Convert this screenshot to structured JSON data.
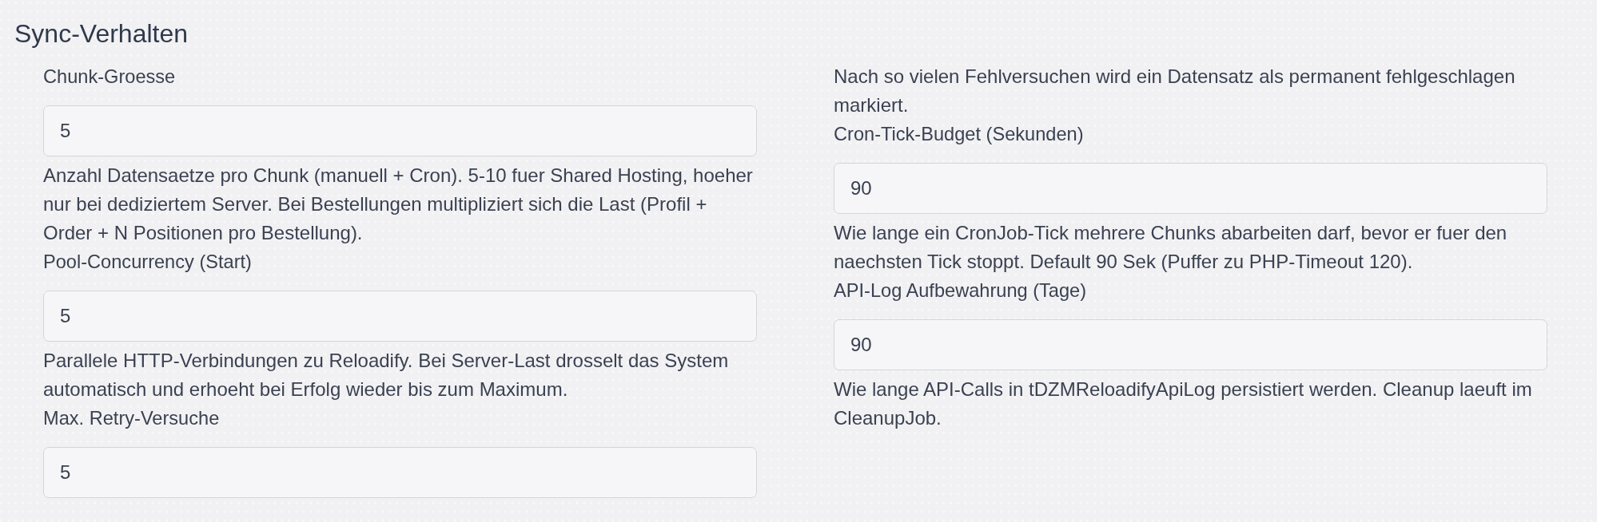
{
  "section": {
    "title": "Sync-Verhalten",
    "columns": [
      {
        "items": [
          {
            "kind": "label",
            "text": "Chunk-Groesse"
          },
          {
            "kind": "input",
            "value": "5"
          },
          {
            "kind": "help",
            "text": "Anzahl Datensaetze pro Chunk (manuell + Cron). 5-10 fuer Shared Hosting, hoeher nur bei dediziertem Server. Bei Bestellungen multipliziert sich die Last (Profil + Order + N Positionen pro Bestellung)."
          },
          {
            "kind": "label",
            "text": "Pool-Concurrency (Start)"
          },
          {
            "kind": "input",
            "value": "5"
          },
          {
            "kind": "help",
            "text": "Parallele HTTP-Verbindungen zu Reloadify. Bei Server-Last drosselt das System automatisch und erhoeht bei Erfolg wieder bis zum Maximum."
          },
          {
            "kind": "label",
            "text": "Max. Retry-Versuche"
          },
          {
            "kind": "input",
            "value": "5"
          }
        ]
      },
      {
        "items": [
          {
            "kind": "help",
            "text": "Nach so vielen Fehlversuchen wird ein Datensatz als permanent fehlgeschlagen markiert."
          },
          {
            "kind": "label",
            "text": "Cron-Tick-Budget (Sekunden)"
          },
          {
            "kind": "input",
            "value": "90"
          },
          {
            "kind": "help",
            "text": "Wie lange ein CronJob-Tick mehrere Chunks abarbeiten darf, bevor er fuer den naechsten Tick stoppt. Default 90 Sek (Puffer zu PHP-Timeout 120)."
          },
          {
            "kind": "label",
            "text": "API-Log Aufbewahrung (Tage)"
          },
          {
            "kind": "input",
            "value": "90"
          },
          {
            "kind": "help",
            "text": "Wie lange API-Calls in tDZMReloadifyApiLog persistiert werden. Cleanup laeuft im CleanupJob."
          }
        ]
      }
    ]
  }
}
